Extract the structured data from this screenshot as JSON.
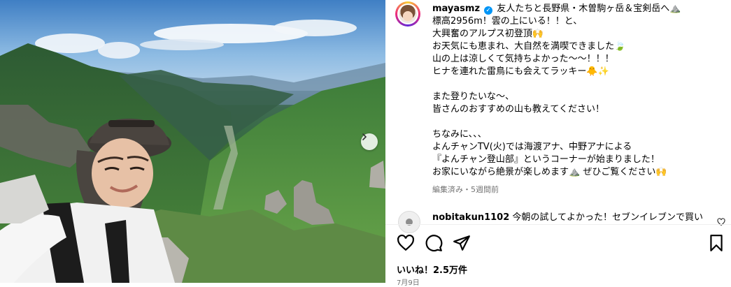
{
  "post": {
    "username": "mayasmz",
    "verified": true,
    "caption_lines": [
      "友人たちと長野県・木曽駒ヶ岳＆宝剣岳へ⛰️",
      "標高2956m！雲の上にいる！！と、",
      "大興奮のアルプス初登頂🙌",
      "お天気にも恵まれ、大自然を満喫できました🍃",
      "山の上は涼しくて気持ちよかった〜〜！！！",
      "ヒナを連れた雷鳥にも会えてラッキー🐥✨",
      "",
      "また登りたいな〜、",
      "皆さんのおすすめの山も教えてください！",
      "",
      "ちなみに、、、",
      "よんチャンTV(火)では海渡アナ、中野アナによる",
      "『よんチャン登山部』というコーナーが始まりました！",
      "お家にいながら絶景が楽しめます⛰️ ぜひご覧ください🙌"
    ],
    "meta": "編集済み・5週間前",
    "likes": "いいね！2.5万件",
    "date": "7月9日"
  },
  "comment": {
    "username": "nobitakun1102",
    "text": "今朝の試してよかった！セブンイレブンで買い"
  },
  "icons": {
    "verified": "verified-badge-icon",
    "like": "heart-icon",
    "comment": "comment-bubble-icon",
    "share": "paper-plane-icon",
    "save": "bookmark-icon",
    "next": "chevron-right-icon"
  },
  "colors": {
    "verified": "#0095f6",
    "secondary_text": "#737373",
    "avatar_ring_start": "#f9ce34",
    "avatar_ring_end": "#ee2a7b"
  }
}
